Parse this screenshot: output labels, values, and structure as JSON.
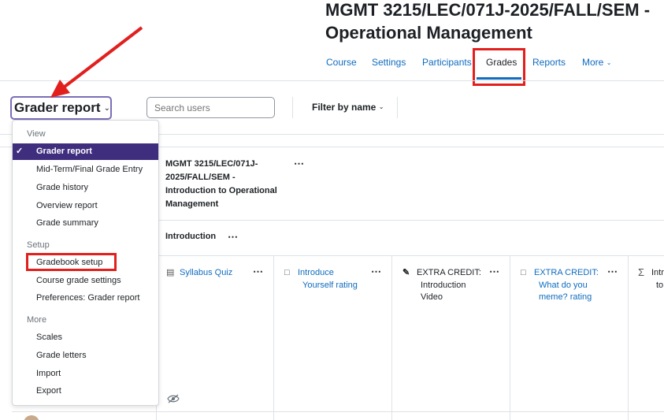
{
  "course": {
    "title_line1": "MGMT 3215/LEC/071J-2025/FALL/SEM -",
    "title_line2": "Operational Management"
  },
  "tabs": [
    {
      "label": "Course"
    },
    {
      "label": "Settings"
    },
    {
      "label": "Participants"
    },
    {
      "label": "Grades"
    },
    {
      "label": "Reports"
    },
    {
      "label": "More"
    }
  ],
  "toolbar": {
    "report_select": "Grader report",
    "search_placeholder": "Search users",
    "filter_label": "Filter by name"
  },
  "menu": {
    "view_header": "View",
    "view_items": [
      "Grader report",
      "Mid-Term/Final Grade Entry",
      "Grade history",
      "Overview report",
      "Grade summary"
    ],
    "setup_header": "Setup",
    "setup_items": [
      "Gradebook setup",
      "Course grade settings",
      "Preferences: Grader report"
    ],
    "more_header": "More",
    "more_items": [
      "Scales",
      "Grade letters",
      "Import",
      "Export"
    ]
  },
  "grid": {
    "category_title_lines": [
      "MGMT 3215/LEC/071J-",
      "2025/FALL/SEM -",
      "Introduction to Operational",
      "Management"
    ],
    "subcategory": "Introduction",
    "items": [
      {
        "lines": [
          "Syllabus Quiz"
        ],
        "icon": "quiz-icon"
      },
      {
        "lines": [
          "Introduce",
          "Yourself rating"
        ],
        "icon": "forum-icon"
      },
      {
        "lines": [
          "EXTRA CREDIT:",
          "Introduction",
          "Video"
        ],
        "icon": "assignment-icon"
      },
      {
        "lines": [
          "EXTRA CREDIT:",
          "What do you",
          "meme? rating"
        ],
        "icon": "forum-icon"
      },
      {
        "lines": [
          "Intr",
          "to"
        ],
        "icon": "sigma-icon"
      }
    ]
  },
  "colors": {
    "accent": "#0f6cbf",
    "selected": "#3f2e7d",
    "annotation_red": "#e1201d"
  }
}
